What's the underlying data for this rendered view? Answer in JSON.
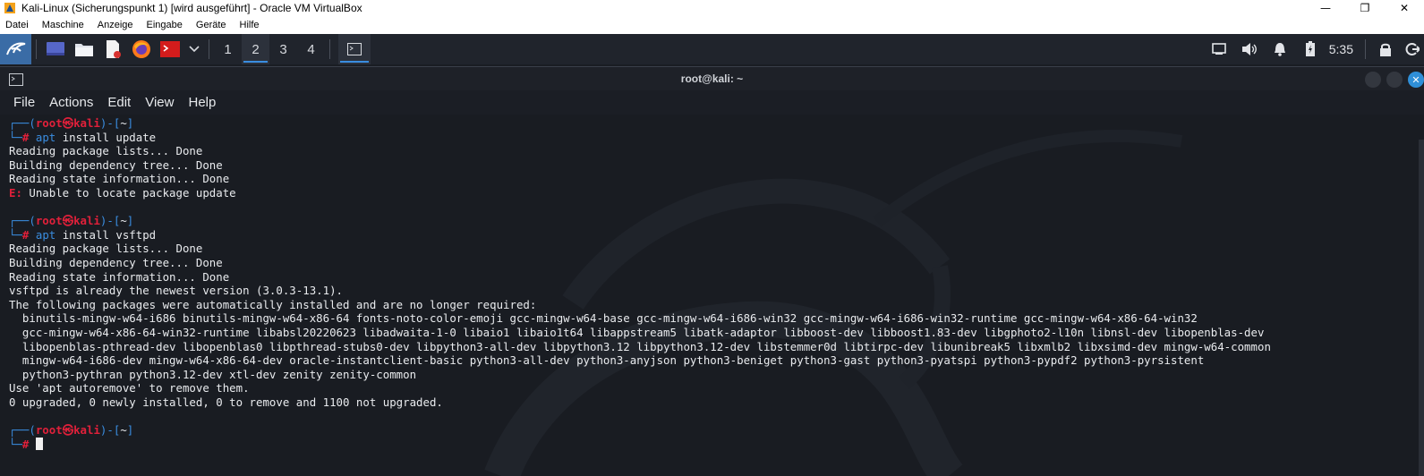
{
  "host": {
    "title": "Kali-Linux (Sicherungspunkt 1) [wird ausgeführt] - Oracle VM VirtualBox",
    "menu": [
      "Datei",
      "Maschine",
      "Anzeige",
      "Eingabe",
      "Geräte",
      "Hilfe"
    ],
    "window_buttons": [
      "minimize-icon",
      "restore-icon",
      "close-icon"
    ]
  },
  "panel": {
    "workspaces": [
      "1",
      "2",
      "3",
      "4"
    ],
    "active_workspace": "2",
    "clock": "5:35",
    "apps": [
      "kali-menu-icon",
      "desktop-icon",
      "file-manager-icon",
      "text-editor-icon",
      "firefox-icon",
      "terminal-emulator-icon",
      "chevron-down-icon"
    ],
    "tray": [
      "display-icon",
      "volume-icon",
      "notification-bell-icon",
      "battery-icon",
      "lock-icon",
      "logout-icon"
    ]
  },
  "terminal": {
    "title": "root@kali: ~",
    "menu": [
      "File",
      "Actions",
      "Edit",
      "View",
      "Help"
    ],
    "prompt": {
      "open": "┌──(",
      "user": "root",
      "at": "㉿",
      "host": "kali",
      "mid": ")-[",
      "dir": "~",
      "close": "]",
      "corner": "└─",
      "hash": "#"
    },
    "lines": [
      {
        "kind": "prompt1"
      },
      {
        "kind": "cmd",
        "cmd": "apt",
        "args": " install update"
      },
      {
        "kind": "out",
        "text": "Reading package lists... Done"
      },
      {
        "kind": "out",
        "text": "Building dependency tree... Done"
      },
      {
        "kind": "out",
        "text": "Reading state information... Done"
      },
      {
        "kind": "err",
        "label": "E:",
        "text": " Unable to locate package update"
      },
      {
        "kind": "blank"
      },
      {
        "kind": "prompt1"
      },
      {
        "kind": "cmd",
        "cmd": "apt",
        "args": " install vsftpd"
      },
      {
        "kind": "out",
        "text": "Reading package lists... Done"
      },
      {
        "kind": "out",
        "text": "Building dependency tree... Done"
      },
      {
        "kind": "out",
        "text": "Reading state information... Done"
      },
      {
        "kind": "out",
        "text": "vsftpd is already the newest version (3.0.3-13.1)."
      },
      {
        "kind": "out",
        "text": "The following packages were automatically installed and are no longer required:"
      },
      {
        "kind": "out",
        "text": "  binutils-mingw-w64-i686 binutils-mingw-w64-x86-64 fonts-noto-color-emoji gcc-mingw-w64-base gcc-mingw-w64-i686-win32 gcc-mingw-w64-i686-win32-runtime gcc-mingw-w64-x86-64-win32"
      },
      {
        "kind": "out",
        "text": "  gcc-mingw-w64-x86-64-win32-runtime libabsl20220623 libadwaita-1-0 libaio1 libaio1t64 libappstream5 libatk-adaptor libboost-dev libboost1.83-dev libgphoto2-l10n libnsl-dev libopenblas-dev"
      },
      {
        "kind": "out",
        "text": "  libopenblas-pthread-dev libopenblas0 libpthread-stubs0-dev libpython3-all-dev libpython3.12 libpython3.12-dev libstemmer0d libtirpc-dev libunibreak5 libxmlb2 libxsimd-dev mingw-w64-common"
      },
      {
        "kind": "out",
        "text": "  mingw-w64-i686-dev mingw-w64-x86-64-dev oracle-instantclient-basic python3-all-dev python3-anyjson python3-beniget python3-gast python3-pyatspi python3-pypdf2 python3-pyrsistent"
      },
      {
        "kind": "out",
        "text": "  python3-pythran python3.12-dev xtl-dev zenity zenity-common"
      },
      {
        "kind": "out",
        "text": "Use 'apt autoremove' to remove them."
      },
      {
        "kind": "out",
        "text": "0 upgraded, 0 newly installed, 0 to remove and 1100 not upgraded."
      },
      {
        "kind": "blank"
      },
      {
        "kind": "prompt1"
      },
      {
        "kind": "cursor"
      }
    ]
  },
  "colors": {
    "accent_blue": "#3a8de0",
    "prompt_red": "#e0203a",
    "terminal_bg": "#191c22",
    "panel_bg": "#20242c"
  }
}
